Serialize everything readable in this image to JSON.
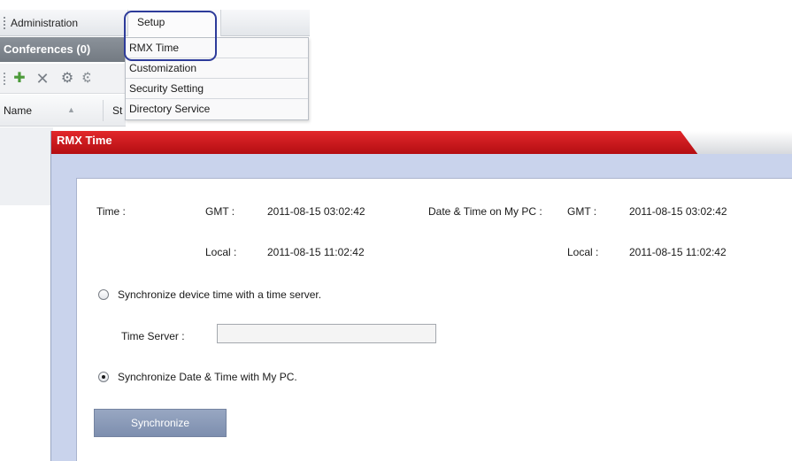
{
  "menubar": {
    "administration_label": "Administration",
    "setup_label": "Setup"
  },
  "conferences": {
    "title": "Conferences (0)"
  },
  "toolbar": {
    "icons": [
      "new-conference-icon",
      "delete-icon",
      "mcu-icon"
    ]
  },
  "grid": {
    "columns": [
      "Name",
      "St"
    ]
  },
  "setup_menu": {
    "items": [
      "RMX Time",
      "Customization",
      "Security Setting",
      "Directory Service"
    ]
  },
  "dialog": {
    "title": "RMX Time",
    "time_label": "Time :",
    "gmt_label": "GMT :",
    "gmt_value": "2011-08-15 03:02:42",
    "local_label": "Local :",
    "local_value": "2011-08-15 11:02:42",
    "pc_label": "Date & Time on My PC :",
    "pc_gmt_label": "GMT :",
    "pc_gmt_value": "2011-08-15 03:02:42",
    "pc_local_label": "Local :",
    "pc_local_value": "2011-08-15 11:02:42",
    "option_time_server": "Synchronize device time with a time server.",
    "time_server_label": "Time Server :",
    "time_server_value": "",
    "option_my_pc": "Synchronize Date & Time with My PC.",
    "synchronize_button": "Synchronize",
    "selected_option": "my_pc"
  },
  "colors": {
    "title_bar": "#c8161b",
    "dialog_background": "#c9d3ec",
    "button": "#8a9ab8",
    "highlight_ring": "#2d3b9a"
  }
}
